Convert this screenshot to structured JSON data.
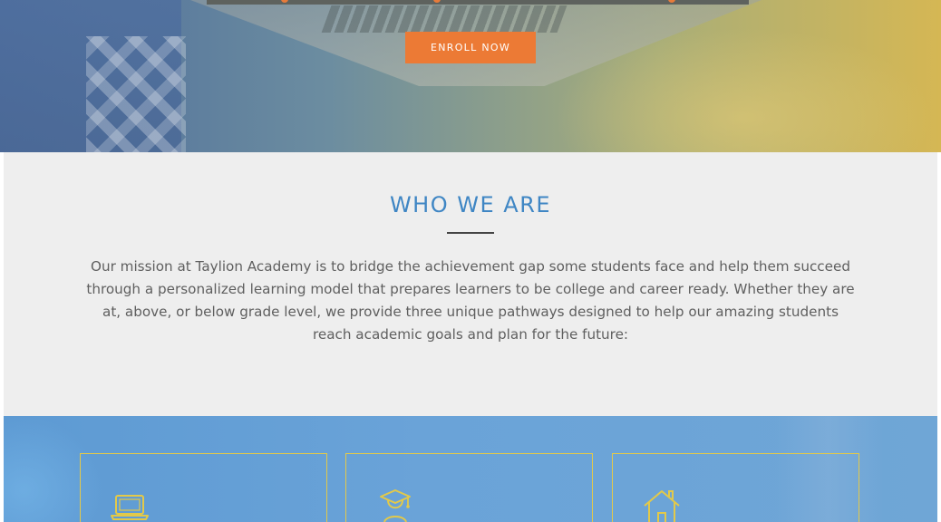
{
  "hero": {
    "enroll_label": "ENROLL NOW"
  },
  "about": {
    "heading": "WHO WE ARE",
    "body": "Our mission at Taylion Academy is to bridge the achievement gap some students face and help them succeed through a personalized learning model that prepares learners to be college and career ready. Whether they are at, above, or below grade level, we provide three unique pathways designed to help our amazing students reach academic goals and plan for the future:"
  },
  "pathways": {
    "cards": [
      {
        "icon": "laptop-icon"
      },
      {
        "icon": "graduate-icon"
      },
      {
        "icon": "home-icon"
      }
    ]
  },
  "colors": {
    "accent_orange": "#ec7a35",
    "heading_blue": "#3f86c4",
    "card_border_gold": "#e3c949",
    "section_gray": "#eeeeee"
  }
}
